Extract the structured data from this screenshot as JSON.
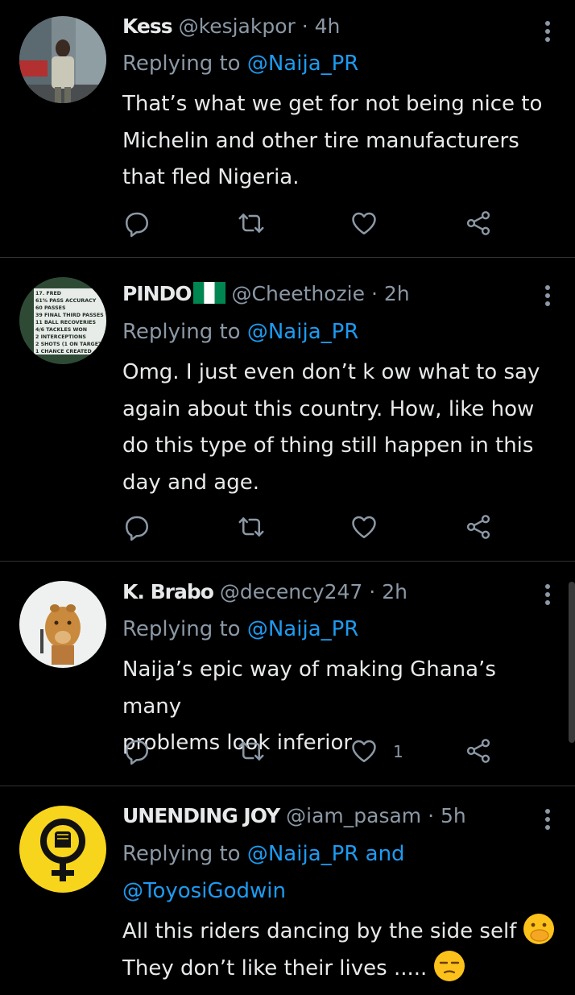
{
  "tweets": [
    {
      "name": "Kess",
      "handle": "@kesjakpor",
      "time": "· 4h",
      "replying_prefix": "Replying to",
      "mentions": [
        "@Naija_PR"
      ],
      "lines": [
        "That’s what we get for not being nice to",
        "Michelin and other tire manufacturers",
        "that fled Nigeria."
      ]
    },
    {
      "name": "PINDO",
      "handle": "@Cheethozie",
      "time": "· 2h",
      "replying_prefix": "Replying to",
      "mentions": [
        "@Naija_PR"
      ],
      "lines": [
        "Omg.  I just even don’t k ow what to say",
        "again about this country.  How, like how",
        "do this type of thing still happen in this",
        "day and age."
      ],
      "avatar_text": [
        "17. FRED",
        "61% PASS ACCURACY",
        "60 PASSES",
        "39 FINAL THIRD PASSES",
        "11 BALL RECOVERIES",
        "4/6 TACKLES WON",
        "2 INTERCEPTIONS",
        "2 SHOTS (1 ON TARGET)",
        "1 CHANCE CREATED"
      ]
    },
    {
      "name": "K. Brabo",
      "handle": "@decency247",
      "time": "· 2h",
      "replying_prefix": "Replying to",
      "mentions": [
        "@Naija_PR"
      ],
      "lines": [
        "Naija’s epic way of making Ghana’s many",
        "problems look inferior"
      ],
      "like_count": "1"
    },
    {
      "name": "UNENDING JOY",
      "handle": "@iam_pasam",
      "time": "· 5h",
      "replying_prefix": "Replying to",
      "mentions": [
        "@Naija_PR",
        "@ToyosiGodwin"
      ],
      "mention_joiner": "and",
      "lines": [
        "All this riders dancing by the side self",
        "They don’t like their lives ....."
      ]
    }
  ],
  "icons": [
    "reply-icon",
    "retweet-icon",
    "like-icon",
    "share-icon",
    "more-icon"
  ],
  "colors": {
    "background": "#000000",
    "accent": "#1d9bf0",
    "secondary_text": "#8b98a5",
    "divider": "#2f3336"
  }
}
